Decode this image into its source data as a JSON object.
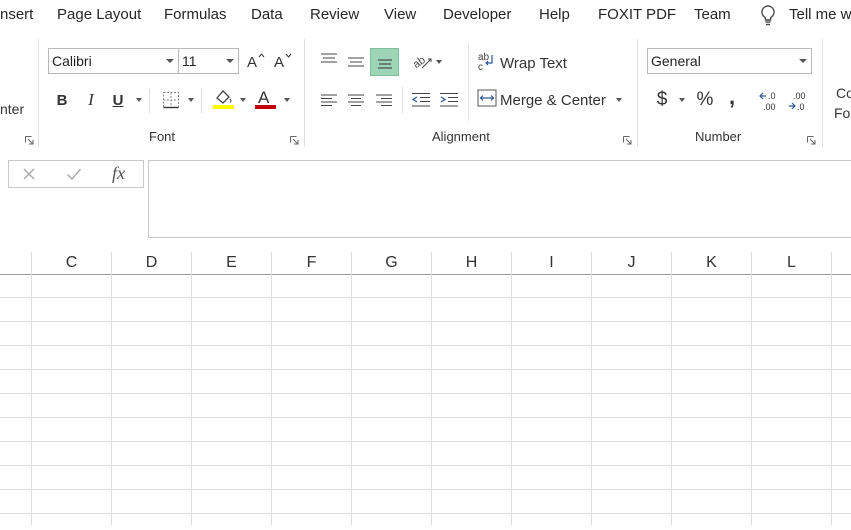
{
  "tabs": [
    {
      "label": "nsert"
    },
    {
      "label": "Page Layout"
    },
    {
      "label": "Formulas"
    },
    {
      "label": "Data"
    },
    {
      "label": "Review"
    },
    {
      "label": "View"
    },
    {
      "label": "Developer"
    },
    {
      "label": "Help"
    },
    {
      "label": "FOXIT PDF"
    },
    {
      "label": "Team"
    }
  ],
  "tell_me": "Tell me w",
  "ribbon": {
    "clipboard_partial": "nter",
    "font": {
      "name": "Calibri",
      "size": "11",
      "group_label": "Font",
      "bold": "B",
      "italic": "I",
      "underline": "U",
      "font_color": "#c00000",
      "highlight_color": "#ffff00"
    },
    "alignment": {
      "wrap_text": "Wrap Text",
      "merge_center": "Merge & Center",
      "group_label": "Alignment"
    },
    "number": {
      "format": "General",
      "currency": "$",
      "percent": "%",
      "comma": ",",
      "group_label": "Number"
    },
    "styles_partial_1": "Co",
    "styles_partial_2": "Fo"
  },
  "formula_bar": {
    "fx_label": "fx",
    "value": ""
  },
  "columns": [
    "C",
    "D",
    "E",
    "F",
    "G",
    "H",
    "I",
    "J",
    "K",
    "L"
  ],
  "colors": {
    "accent_selected": "#9fd5b7"
  }
}
